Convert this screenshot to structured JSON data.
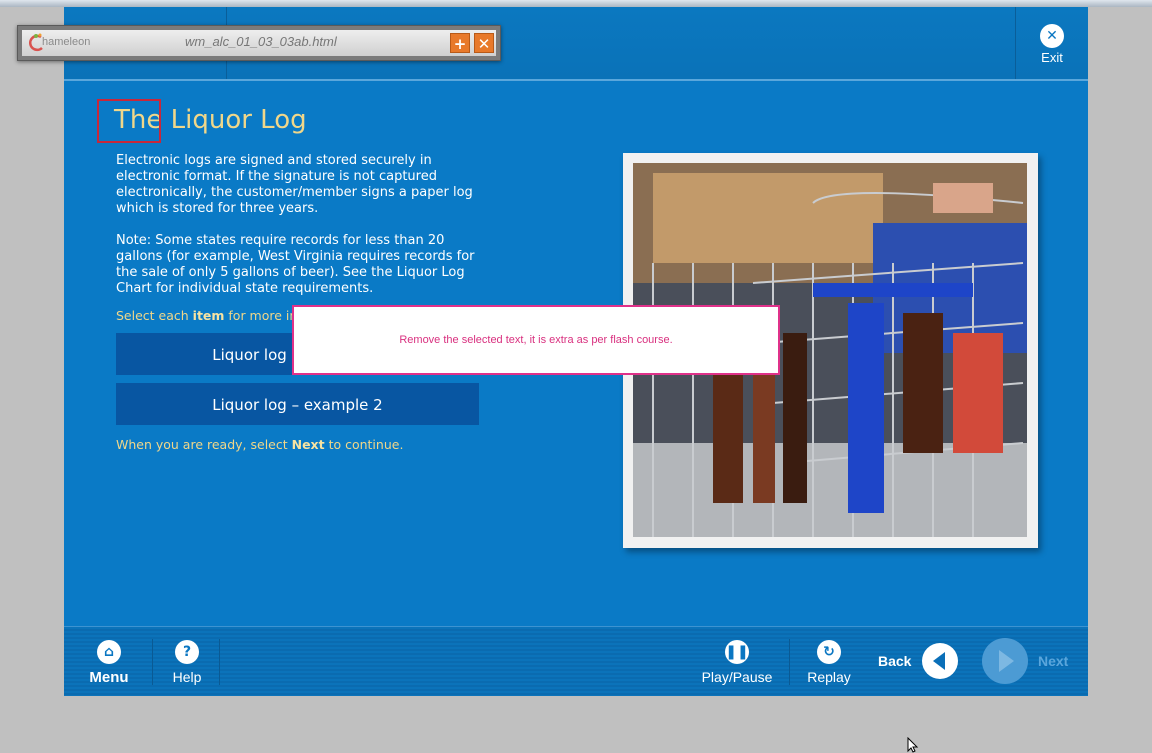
{
  "viewer": {
    "brand": "hameleon",
    "filename": "wm_alc_01_03_03ab.html",
    "add_symbol": "+",
    "close_symbol": "✕",
    "icons": {
      "add": "plus-icon",
      "close": "close-icon",
      "logo": "chameleon-logo-icon"
    }
  },
  "header": {
    "exit_label": "Exit",
    "exit_icon": "close-circle-icon"
  },
  "page": {
    "title_word1": "The",
    "title_rest": " Liquor Log",
    "paragraph1": "Electronic logs are signed and stored securely in electronic format.  If the signature is not captured electronically, the customer/member signs a paper log which is stored for three years.",
    "paragraph2": "Note: Some states require records for less than 20 gallons (for example, West Virginia requires records for the sale of only 5 gallons of beer).  See the Liquor Log Chart for individual state requirements.",
    "select_prefix": "Select each ",
    "select_bold": "item",
    "select_suffix": " for more info",
    "buttons": [
      {
        "label": "Liquor log – example 1"
      },
      {
        "label": "Liquor log – example 2"
      }
    ],
    "continue_prefix": "When you are ready, select ",
    "continue_bold": "Next",
    "continue_suffix": " to continue."
  },
  "comment": {
    "text": "Remove the selected text, it is extra as per flash course."
  },
  "footer": {
    "menu_label": "Menu",
    "help_label": "Help",
    "play_label": "Play/Pause",
    "replay_label": "Replay",
    "back_label": "Back",
    "next_label": "Next",
    "icons": {
      "menu": "home-icon",
      "help": "help-icon",
      "play": "pause-icon",
      "replay": "replay-icon",
      "back": "arrow-left-icon",
      "next": "arrow-right-icon"
    }
  },
  "colors": {
    "course_blue": "#0a7ac6",
    "title_gold": "#f0d78a",
    "button_dark_blue": "#0856a2",
    "comment_pink": "#e0318a",
    "highlight_red": "#c8273a"
  }
}
